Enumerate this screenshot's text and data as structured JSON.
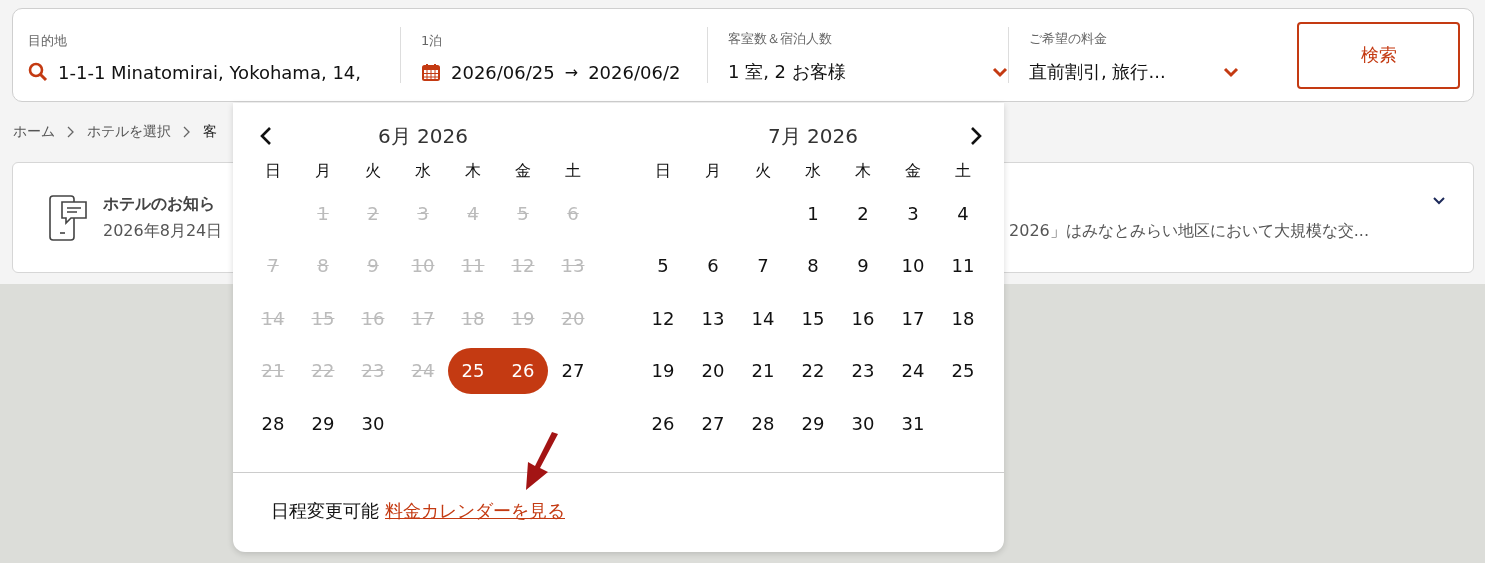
{
  "search_bar": {
    "destination": {
      "label": "目的地",
      "value": "1-1-1 Minatomirai, Yokohama, 14,"
    },
    "dates": {
      "label": "1泊",
      "check_in": "2026/06/25",
      "arrow": "→",
      "check_out": "2026/06/2"
    },
    "guests": {
      "label": "客室数＆宿泊人数",
      "value": "1 室, 2 お客様"
    },
    "rates": {
      "label": "ご希望の料金",
      "value": "直前割引, 旅行..."
    },
    "search_button": "検索"
  },
  "breadcrumb": [
    {
      "label": "ホーム",
      "kind": "link"
    },
    {
      "label": "ホテルを選択",
      "kind": "link"
    },
    {
      "label": "客",
      "kind": "current"
    }
  ],
  "notice": {
    "title": "ホテルのお知ら",
    "date": "2026年8月24日",
    "text": "2026」はみなとみらい地区において大規模な交...",
    "expanded": false
  },
  "calendar": {
    "months": [
      {
        "title": "6月 2026",
        "weekdays": [
          "日",
          "月",
          "火",
          "水",
          "木",
          "金",
          "土"
        ],
        "weeks": [
          [
            {
              "kind": "empty"
            },
            {
              "kind": "day",
              "day": "1",
              "disabled": true,
              "selected": false
            },
            {
              "kind": "day",
              "day": "2",
              "disabled": true,
              "selected": false
            },
            {
              "kind": "day",
              "day": "3",
              "disabled": true,
              "selected": false
            },
            {
              "kind": "day",
              "day": "4",
              "disabled": true,
              "selected": false
            },
            {
              "kind": "day",
              "day": "5",
              "disabled": true,
              "selected": false
            },
            {
              "kind": "day",
              "day": "6",
              "disabled": true,
              "selected": false
            }
          ],
          [
            {
              "kind": "day",
              "day": "7",
              "disabled": true,
              "selected": false
            },
            {
              "kind": "day",
              "day": "8",
              "disabled": true,
              "selected": false
            },
            {
              "kind": "day",
              "day": "9",
              "disabled": true,
              "selected": false
            },
            {
              "kind": "day",
              "day": "10",
              "disabled": true,
              "selected": false
            },
            {
              "kind": "day",
              "day": "11",
              "disabled": true,
              "selected": false
            },
            {
              "kind": "day",
              "day": "12",
              "disabled": true,
              "selected": false
            },
            {
              "kind": "day",
              "day": "13",
              "disabled": true,
              "selected": false
            }
          ],
          [
            {
              "kind": "day",
              "day": "14",
              "disabled": true,
              "selected": false
            },
            {
              "kind": "day",
              "day": "15",
              "disabled": true,
              "selected": false
            },
            {
              "kind": "day",
              "day": "16",
              "disabled": true,
              "selected": false
            },
            {
              "kind": "day",
              "day": "17",
              "disabled": true,
              "selected": false
            },
            {
              "kind": "day",
              "day": "18",
              "disabled": true,
              "selected": false
            },
            {
              "kind": "day",
              "day": "19",
              "disabled": true,
              "selected": false
            },
            {
              "kind": "day",
              "day": "20",
              "disabled": true,
              "selected": false
            }
          ],
          [
            {
              "kind": "day",
              "day": "21",
              "disabled": true,
              "selected": false
            },
            {
              "kind": "day",
              "day": "22",
              "disabled": true,
              "selected": false
            },
            {
              "kind": "day",
              "day": "23",
              "disabled": true,
              "selected": false
            },
            {
              "kind": "day",
              "day": "24",
              "disabled": true,
              "selected": false
            },
            {
              "kind": "day",
              "day": "25",
              "disabled": false,
              "selected": true
            },
            {
              "kind": "day",
              "day": "26",
              "disabled": false,
              "selected": true
            },
            {
              "kind": "day",
              "day": "27",
              "disabled": false,
              "selected": false
            }
          ],
          [
            {
              "kind": "day",
              "day": "28",
              "disabled": false,
              "selected": false
            },
            {
              "kind": "day",
              "day": "29",
              "disabled": false,
              "selected": false
            },
            {
              "kind": "day",
              "day": "30",
              "disabled": false,
              "selected": false
            },
            {
              "kind": "empty"
            },
            {
              "kind": "empty"
            },
            {
              "kind": "empty"
            },
            {
              "kind": "empty"
            }
          ]
        ]
      },
      {
        "title": "7月 2026",
        "weekdays": [
          "日",
          "月",
          "火",
          "水",
          "木",
          "金",
          "土"
        ],
        "weeks": [
          [
            {
              "kind": "empty"
            },
            {
              "kind": "empty"
            },
            {
              "kind": "empty"
            },
            {
              "kind": "day",
              "day": "1",
              "disabled": false,
              "selected": false
            },
            {
              "kind": "day",
              "day": "2",
              "disabled": false,
              "selected": false
            },
            {
              "kind": "day",
              "day": "3",
              "disabled": false,
              "selected": false
            },
            {
              "kind": "day",
              "day": "4",
              "disabled": false,
              "selected": false
            }
          ],
          [
            {
              "kind": "day",
              "day": "5",
              "disabled": false,
              "selected": false
            },
            {
              "kind": "day",
              "day": "6",
              "disabled": false,
              "selected": false
            },
            {
              "kind": "day",
              "day": "7",
              "disabled": false,
              "selected": false
            },
            {
              "kind": "day",
              "day": "8",
              "disabled": false,
              "selected": false
            },
            {
              "kind": "day",
              "day": "9",
              "disabled": false,
              "selected": false
            },
            {
              "kind": "day",
              "day": "10",
              "disabled": false,
              "selected": false
            },
            {
              "kind": "day",
              "day": "11",
              "disabled": false,
              "selected": false
            }
          ],
          [
            {
              "kind": "day",
              "day": "12",
              "disabled": false,
              "selected": false
            },
            {
              "kind": "day",
              "day": "13",
              "disabled": false,
              "selected": false
            },
            {
              "kind": "day",
              "day": "14",
              "disabled": false,
              "selected": false
            },
            {
              "kind": "day",
              "day": "15",
              "disabled": false,
              "selected": false
            },
            {
              "kind": "day",
              "day": "16",
              "disabled": false,
              "selected": false
            },
            {
              "kind": "day",
              "day": "17",
              "disabled": false,
              "selected": false
            },
            {
              "kind": "day",
              "day": "18",
              "disabled": false,
              "selected": false
            }
          ],
          [
            {
              "kind": "day",
              "day": "19",
              "disabled": false,
              "selected": false
            },
            {
              "kind": "day",
              "day": "20",
              "disabled": false,
              "selected": false
            },
            {
              "kind": "day",
              "day": "21",
              "disabled": false,
              "selected": false
            },
            {
              "kind": "day",
              "day": "22",
              "disabled": false,
              "selected": false
            },
            {
              "kind": "day",
              "day": "23",
              "disabled": false,
              "selected": false
            },
            {
              "kind": "day",
              "day": "24",
              "disabled": false,
              "selected": false
            },
            {
              "kind": "day",
              "day": "25",
              "disabled": false,
              "selected": false
            }
          ],
          [
            {
              "kind": "day",
              "day": "26",
              "disabled": false,
              "selected": false
            },
            {
              "kind": "day",
              "day": "27",
              "disabled": false,
              "selected": false
            },
            {
              "kind": "day",
              "day": "28",
              "disabled": false,
              "selected": false
            },
            {
              "kind": "day",
              "day": "29",
              "disabled": false,
              "selected": false
            },
            {
              "kind": "day",
              "day": "30",
              "disabled": false,
              "selected": false
            },
            {
              "kind": "day",
              "day": "31",
              "disabled": false,
              "selected": false
            },
            {
              "kind": "empty"
            }
          ]
        ]
      }
    ],
    "footer_text": "日程変更可能",
    "footer_link": "料金カレンダーを見る"
  }
}
